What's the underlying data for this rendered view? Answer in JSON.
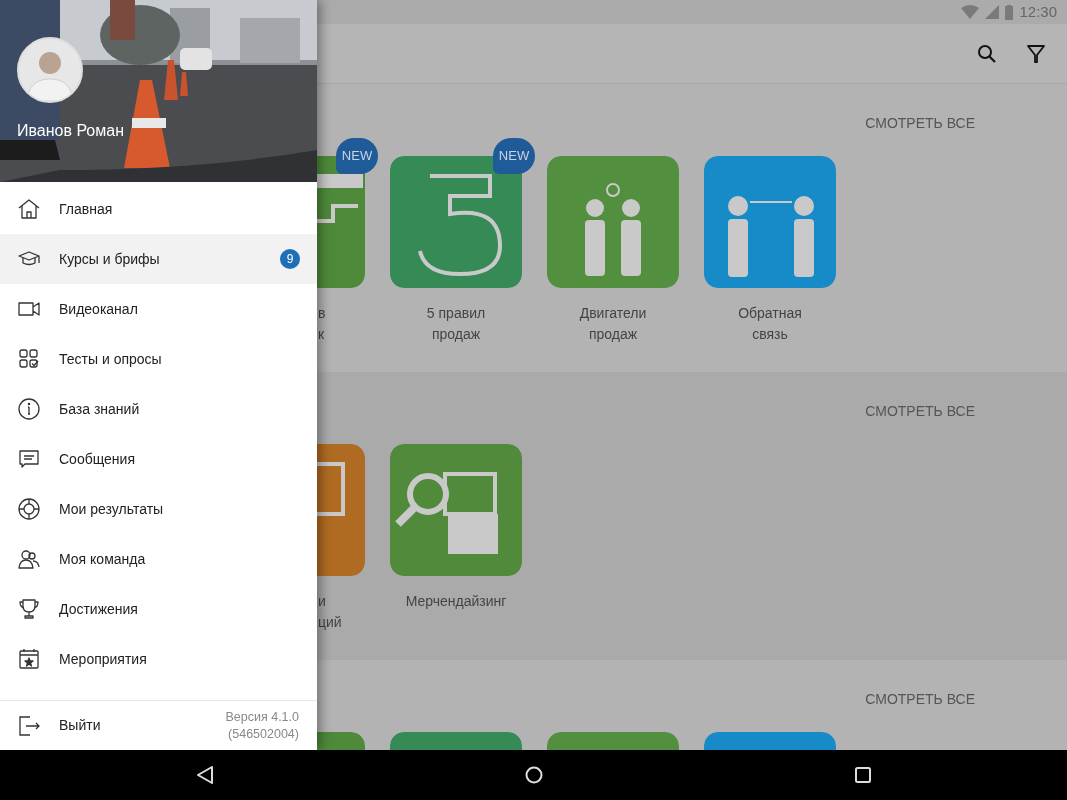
{
  "status_bar": {
    "time": "12:30"
  },
  "sections": [
    {
      "see_all": "СМОТРЕТЬ ВСЕ",
      "tiles": [
        {
          "label_lines": [
            "в",
            "к"
          ],
          "badge": "NEW",
          "color": "#4e8a3a"
        },
        {
          "label_lines": [
            "5 правил",
            "продаж"
          ],
          "badge": "NEW",
          "color": "#358a55"
        },
        {
          "label_lines": [
            "Двигатели",
            "продаж"
          ],
          "color": "#528f3e"
        },
        {
          "label_lines": [
            "Обратная",
            "связь"
          ],
          "color": "#178ac8"
        }
      ]
    },
    {
      "see_all": "СМОТРЕТЬ ВСЕ",
      "tiles": [
        {
          "label_lines": [
            "и",
            "ций"
          ],
          "color": "#b06b22"
        },
        {
          "label_lines": [
            "Мерчендайзинг"
          ],
          "color": "#508a3a"
        }
      ]
    },
    {
      "see_all": "СМОТРЕТЬ ВСЕ",
      "tiles": [
        {
          "color": "#4e8a3a"
        },
        {
          "color": "#358a55"
        },
        {
          "color": "#528f3e"
        },
        {
          "color": "#178ac8"
        }
      ]
    }
  ],
  "drawer": {
    "user_name": "Иванов Роман",
    "menu": [
      {
        "label": "Главная",
        "selected": false
      },
      {
        "label": "Курсы и брифы",
        "selected": true,
        "badge": "9"
      },
      {
        "label": "Видеоканал",
        "selected": false
      },
      {
        "label": "Тесты и опросы",
        "selected": false
      },
      {
        "label": "База знаний",
        "selected": false
      },
      {
        "label": "Сообщения",
        "selected": false
      },
      {
        "label": "Мои результаты",
        "selected": false
      },
      {
        "label": "Моя команда",
        "selected": false
      },
      {
        "label": "Достижения",
        "selected": false
      },
      {
        "label": "Мероприятия",
        "selected": false
      }
    ],
    "footer": {
      "logout": "Выйти",
      "version": "Версия 4.1.0",
      "build": "(546502004)"
    }
  }
}
